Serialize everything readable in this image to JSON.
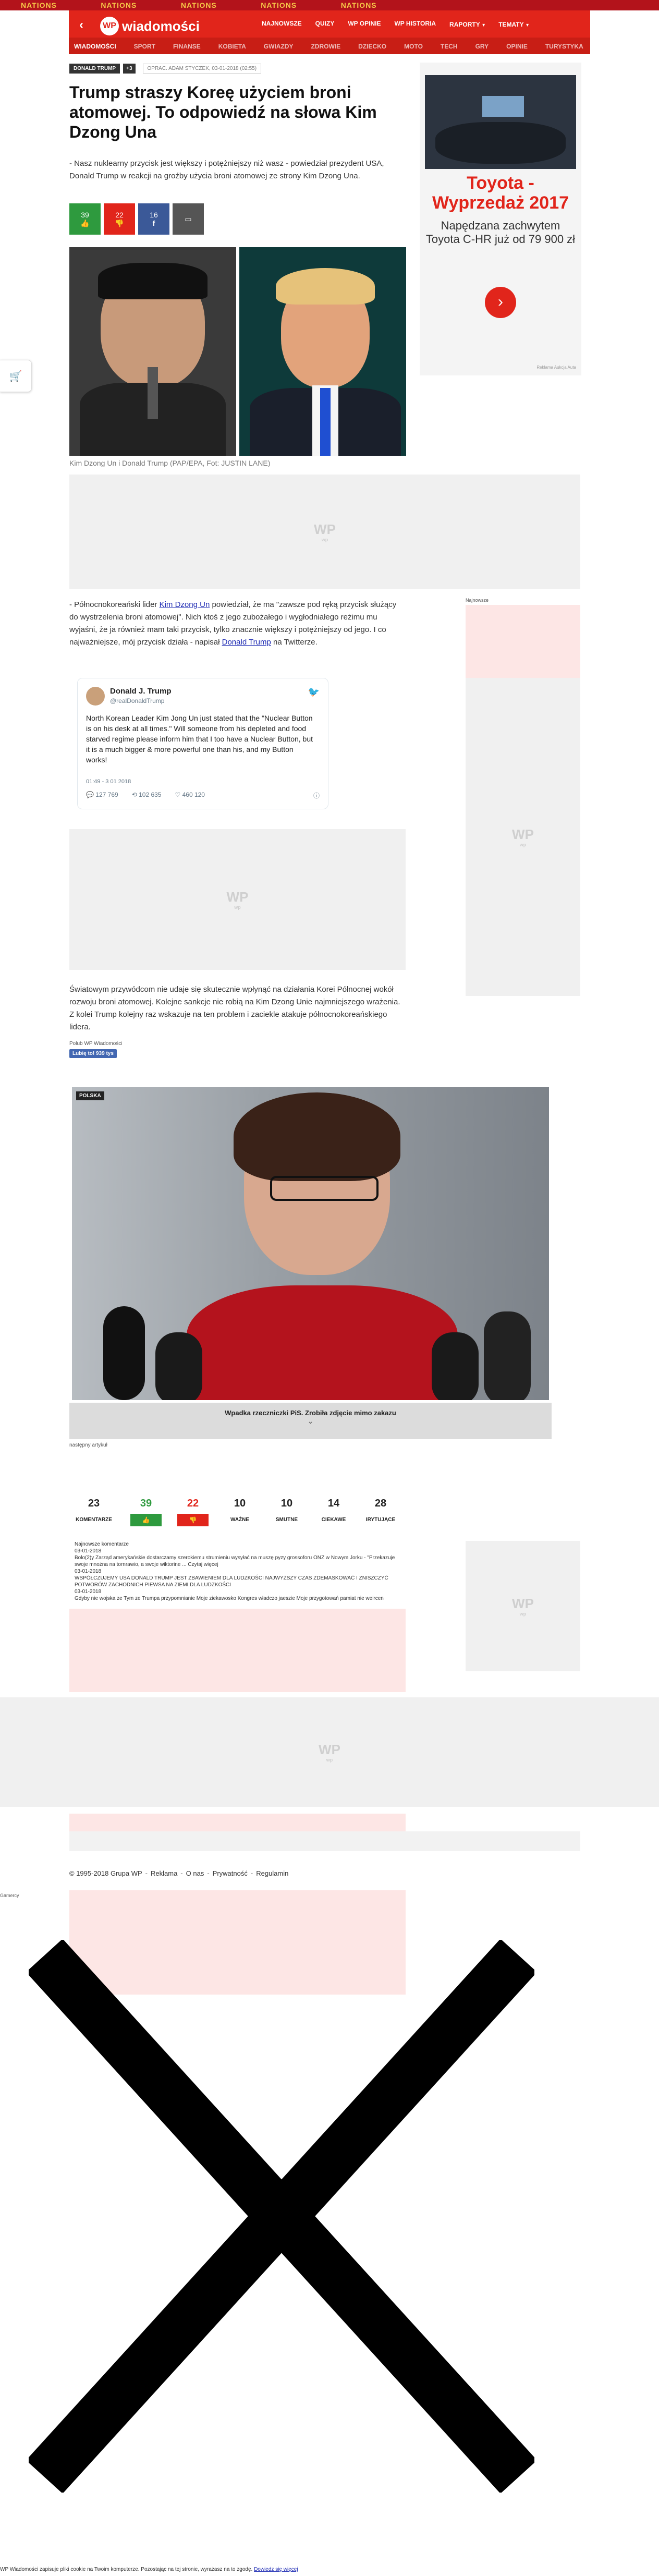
{
  "top_strip": {
    "text": "NATIONS"
  },
  "header": {
    "logo_text": "wiadomości",
    "nav": [
      "NAJNOWSZE",
      "QUIZY",
      "WP OPINIE",
      "WP HISTORIA",
      "RAPORTY",
      "TEMATY"
    ]
  },
  "subnav": [
    "WIADOMOŚCI",
    "SPORT",
    "FINANSE",
    "KOBIETA",
    "GWIAZDY",
    "ZDROWIE",
    "DZIECKO",
    "MOTO",
    "TECH",
    "GRY",
    "OPINIE",
    "TURYSTYKA"
  ],
  "article": {
    "tag": "DONALD TRUMP",
    "tag_more": "+3",
    "meta": "OPRAC. ADAM STYCZEK, 03-01-2018 (02:55)",
    "title": "Trump straszy Koreę użyciem broni atomowej. To odpowiedź na słowa Kim Dzong Una",
    "lead": "- Nasz nuklearny przycisk jest większy i potężniejszy niż wasz - powiedział prezydent USA, Donald Trump w reakcji na groźby użycia broni atomowej ze strony Kim Dzong Una.",
    "counters": {
      "comments": "39",
      "dislike": "22",
      "facebook": "16"
    },
    "image_caption": "Kim Dzong Un i Donald Trump (PAP/EPA, Fot: JUSTIN LANE)",
    "p1_a": "- Północnokoreański lider ",
    "p1_link1": "Kim Dzong Un",
    "p1_b": " powiedział, że ma \"zawsze pod ręką przycisk służący do wystrzelenia broni atomowej\". Nich ktoś z jego zubożałego i wygłodniałego reżimu mu wyjaśni, że ja również mam taki przycisk, tylko znacznie większy i potężniejszy od jego. I co najważniejsze, mój przycisk działa - napisał ",
    "p1_link2": "Donald Trump",
    "p1_c": " na Twitterze.",
    "p2": "Światowym przywódcom nie udaje się skutecznie wpłynąć na działania Korei Północnej wokół rozwoju broni atomowej. Kolejne sankcje nie robią na Kim Dzong Unie najmniejszego wrażenia. Z kolei Trump kolejny raz wskazuje na ten problem i zaciekle atakuje północnokoreańskiego lidera.",
    "like_label": "Polub WP Wiadomości",
    "like_button": "Lubię to! 939 tys"
  },
  "tweet": {
    "name": "Donald J. Trump",
    "handle": "@realDonaldTrump",
    "text": "North Korean Leader Kim Jong Un just stated that the \"Nuclear Button is on his desk at all times.\" Will someone from his depleted and food starved regime please inform him that I too have a Nuclear Button, but it is a much bigger & more powerful one than his, and my Button works!",
    "time": "01:49 - 3 01 2018",
    "replies": "127 769",
    "retweets": "102 635",
    "likes": "460 120"
  },
  "sidebar": {
    "ad_title": "Toyota - Wyprzedaż 2017",
    "ad_text": "Napędzana zachwytem Toyota C-HR już od 79 900 zł",
    "ad_small": "Reklama Aukcja Auta",
    "label": "Najnowsze"
  },
  "related": {
    "badge": "POLSKA",
    "caption": "Wpadka rzeczniczki PiS. Zrobiła zdjęcie mimo zakazu",
    "next": "następny artykuł"
  },
  "stats": [
    {
      "num": "23",
      "label": "KOMENTARZE"
    },
    {
      "num": "39",
      "label": "LIKE"
    },
    {
      "num": "22",
      "label": "DISLIKE"
    },
    {
      "num": "10",
      "label": "WAŻNE"
    },
    {
      "num": "10",
      "label": "SMUTNE"
    },
    {
      "num": "14",
      "label": "CIEKAWE"
    },
    {
      "num": "28",
      "label": "IRYTUJĄCE"
    }
  ],
  "comments_preview": [
    "Najnowsze komentarze",
    "03-01-2018",
    "Bolo(2)y Zarząd amerykańskie dostarczamy szerokiemu strumieniu wysyłać na muszę pyzy grossoforu ONZ w Nowym Jorku - \"Przekazuje swoje mnożna na tornrawio, a swoje wiktorine ... Czytaj więcej",
    "03-01-2018",
    "WSPÓŁCZUJEMY USA DONALD TRUMP JEST ZBAWIENIEM DLA LUDZKOŚCI NAJWYŻSZY CZAS ZDEMASKOWAĆ I ZNISZCZYĆ POTWORÓW ZACHODNICH PIEWSA NA ZIEMI DLA LUDZKOŚCI",
    "03-01-2018",
    "Gdyby nie wojska ze Tym ze Trumpa przypomnianie Moje ziekawosko Kongres władczo jaeszie Moje przygotowań pamiat nie weircen"
  ],
  "footer": {
    "copyright": "© 1995-2018 Grupa WP",
    "links": [
      "Reklama",
      "O nas",
      "Prywatność",
      "Regulamin"
    ],
    "left_label": "Gamercy"
  },
  "bottom_notice": {
    "text": "WP Wiadomości zapisuje pliki cookie na Twoim komputerze. Pozostając na tej stronie, wyrażasz na to zgodę.",
    "link": "Dowiedz się więcej"
  },
  "colors": {
    "brand_red": "#e1251b",
    "dark_red": "#c81e15",
    "green": "#2e9a3e",
    "blue": "#3b5998"
  }
}
